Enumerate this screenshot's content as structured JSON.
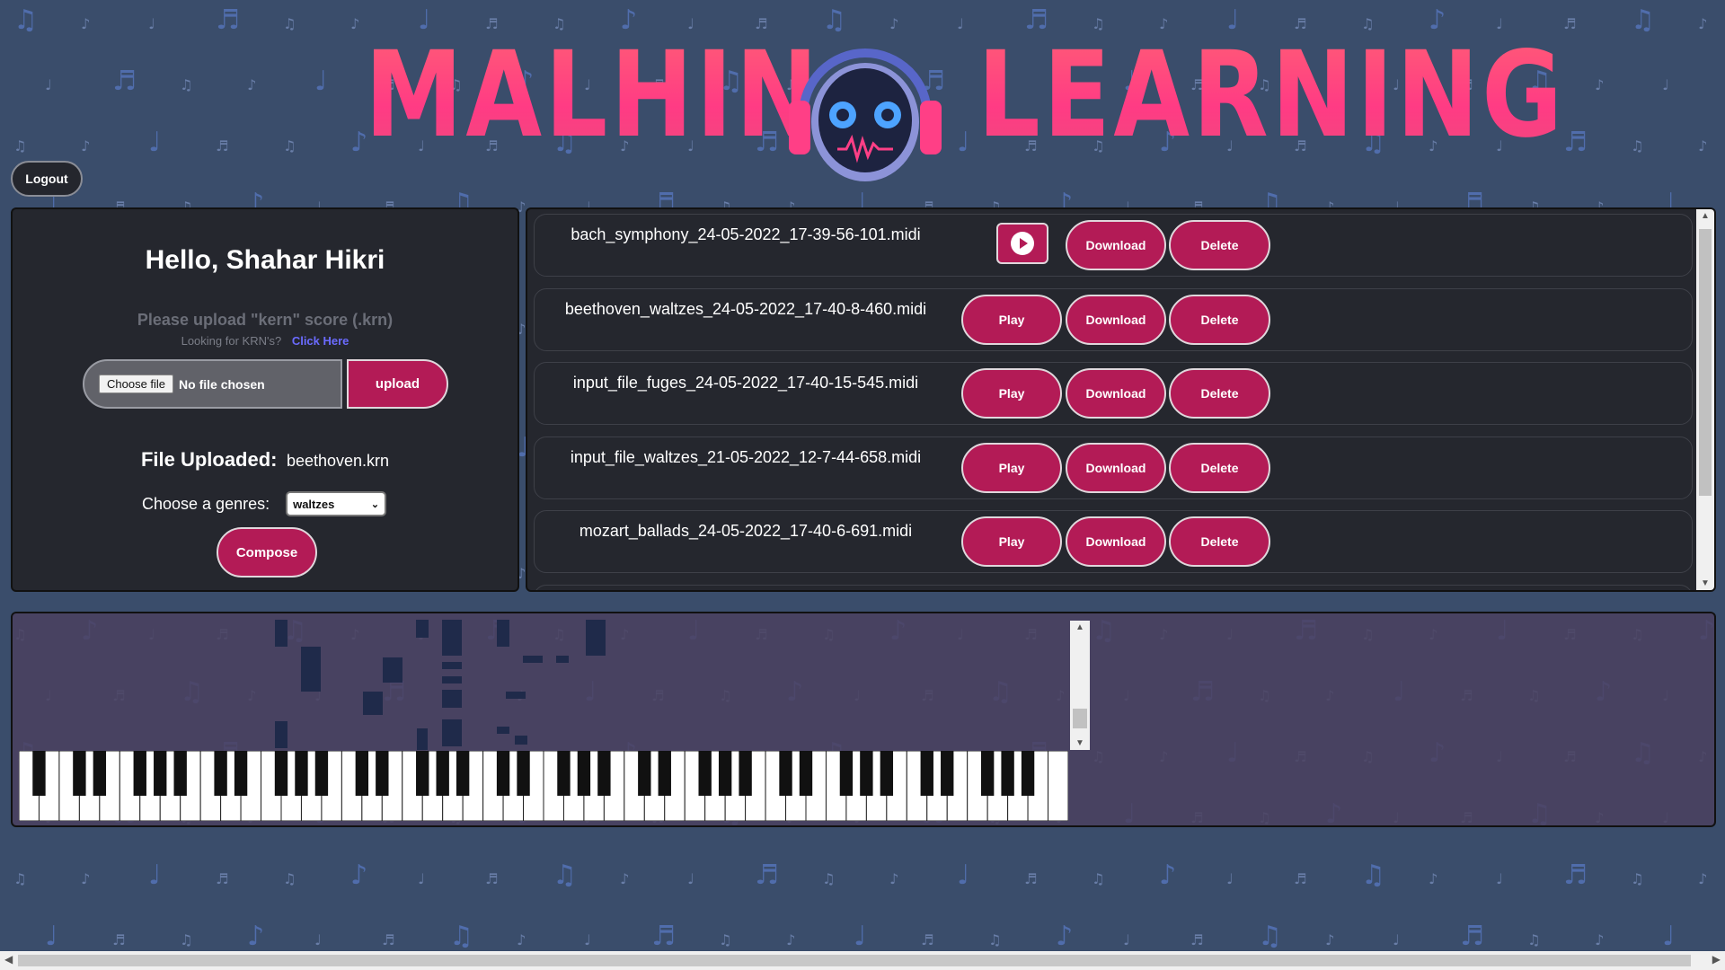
{
  "header": {
    "logo_left": "MALHIN",
    "logo_right": "LEARNING",
    "logo_icon": "robot-headphones-icon"
  },
  "auth": {
    "logout_label": "Logout"
  },
  "upload_panel": {
    "greeting": "Hello, Shahar Hikri",
    "upload_hint": "Please upload \"kern\" score (.krn)",
    "krn_question": "Looking for KRN's?",
    "krn_link": "Click Here",
    "choose_file_label": "Choose file",
    "no_file_label": "No file chosen",
    "upload_label": "upload",
    "file_uploaded_label": "File Uploaded:",
    "file_uploaded_value": "beethoven.krn",
    "genre_label": "Choose a genres:",
    "genre_selected": "waltzes",
    "compose_label": "Compose"
  },
  "files": {
    "play_label": "Play",
    "download_label": "Download",
    "delete_label": "Delete",
    "items": [
      {
        "name": "bach_symphony_24-05-2022_17-39-56-101.midi",
        "playing": true
      },
      {
        "name": "beethoven_waltzes_24-05-2022_17-40-8-460.midi",
        "playing": false
      },
      {
        "name": "input_file_fuges_24-05-2022_17-40-15-545.midi",
        "playing": false
      },
      {
        "name": "input_file_waltzes_21-05-2022_12-7-44-658.midi",
        "playing": false
      },
      {
        "name": "mozart_ballads_24-05-2022_17-40-6-691.midi",
        "playing": false
      }
    ]
  },
  "colors": {
    "accent": "#b31b56",
    "panel": "#25272e",
    "background": "#3a4d6b",
    "logo": "#ff3b84"
  }
}
